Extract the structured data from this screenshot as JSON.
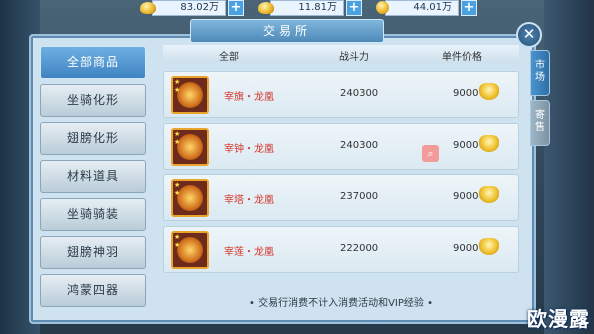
{
  "currency": [
    {
      "icon": "gold-ingot-icon",
      "value": "83.02万"
    },
    {
      "icon": "silver-ingot-icon",
      "value": "11.81万"
    },
    {
      "icon": "coin-icon",
      "value": "44.01万"
    }
  ],
  "window": {
    "title": "交易所",
    "close_label": "✕"
  },
  "categories": [
    "全部商品",
    "坐骑化形",
    "翅膀化形",
    "材料道具",
    "坐骑骑装",
    "翅膀神羽",
    "鸿蒙四器"
  ],
  "table": {
    "headers": [
      "全部",
      "战斗力",
      "单件价格"
    ]
  },
  "items": [
    {
      "name": "宰旗・龙凰",
      "power": "240300",
      "price": "9000"
    },
    {
      "name": "宰钟・龙凰",
      "power": "240300",
      "price": "9000"
    },
    {
      "name": "宰塔・龙凰",
      "power": "237000",
      "price": "9000"
    },
    {
      "name": "宰莲・龙凰",
      "power": "222000",
      "price": "9000"
    }
  ],
  "footer_note": "• 交易行消费不计入消费活动和VIP经验 •",
  "side_tabs": [
    {
      "label": "市\n场",
      "active": true
    },
    {
      "label": "寄\n售",
      "active": false
    }
  ],
  "watermark": "欧漫露",
  "colors": {
    "accent": "#4f8fca",
    "item_name": "#d4352b",
    "frame": "#e7a52c"
  }
}
